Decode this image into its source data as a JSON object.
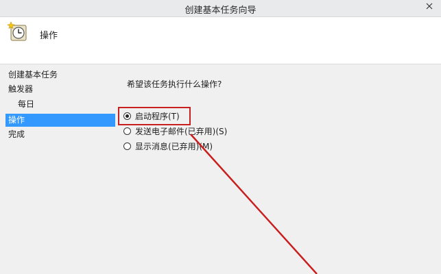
{
  "window": {
    "title": "创建基本任务向导"
  },
  "header": {
    "title": "操作",
    "icon": "clock-wizard-icon"
  },
  "sidebar": {
    "items": [
      {
        "label": "创建基本任务"
      },
      {
        "label": "触发器"
      },
      {
        "label": "每日"
      },
      {
        "label": "操作"
      },
      {
        "label": "完成"
      }
    ]
  },
  "main": {
    "question": "希望该任务执行什么操作?",
    "options": [
      {
        "label": "启动程序(T)",
        "checked": true
      },
      {
        "label": "发送电子邮件(已弃用)(S)",
        "checked": false
      },
      {
        "label": "显示消息(已弃用)(M)",
        "checked": false
      }
    ]
  },
  "colors": {
    "selection": "#3399ff",
    "annotation_red": "#c81e1e"
  }
}
